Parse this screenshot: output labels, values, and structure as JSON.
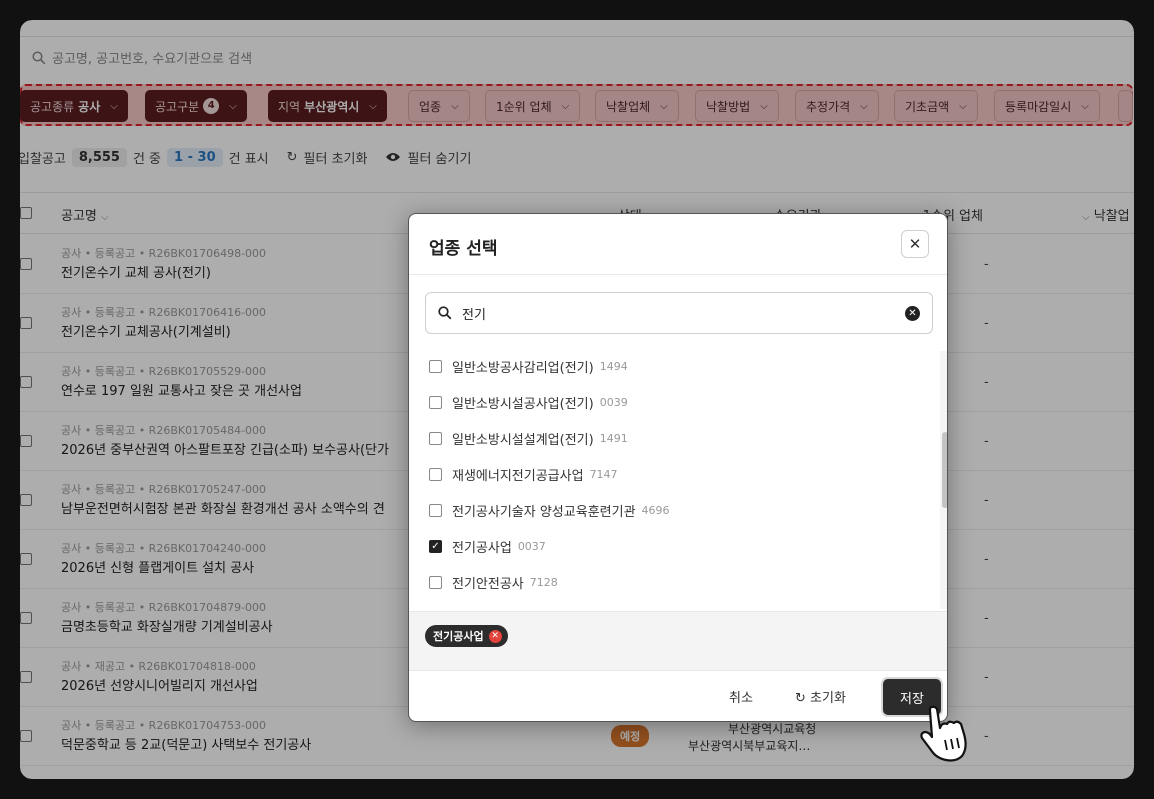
{
  "search": {
    "placeholder": "공고명, 공고번호, 수요기관으로 검색"
  },
  "filters": [
    {
      "label": "공고종류",
      "value": "공사",
      "active": true
    },
    {
      "label": "공고구분",
      "count": "4",
      "active": true
    },
    {
      "label": "지역",
      "value": "부산광역시",
      "active": true
    },
    {
      "label": "업종"
    },
    {
      "label": "1순위 업체"
    },
    {
      "label": "낙찰업체"
    },
    {
      "label": "낙찰방법"
    },
    {
      "label": "추정가격"
    },
    {
      "label": "기초금액"
    },
    {
      "label": "등록마감일시"
    }
  ],
  "stats": {
    "prefix": "입찰공고",
    "total": "8,555",
    "unit": "건 중",
    "range": "1 - 30",
    "suffix": "건 표시",
    "reset_filter": "필터 초기화",
    "hide_filter": "필터 숨기기"
  },
  "table": {
    "headers": {
      "name": "공고명",
      "status": "상태",
      "agency": "수요기관",
      "first_rank": "1순위 업체",
      "winner": "낙찰업"
    },
    "rows": [
      {
        "meta": "공사 • 등록공고 • R26BK01706498-000",
        "title": "전기온수기 교체 공사(전기)",
        "first_rank": "-"
      },
      {
        "meta": "공사 • 등록공고 • R26BK01706416-000",
        "title": "전기온수기 교체공사(기계설비)",
        "first_rank": "-"
      },
      {
        "meta": "공사 • 등록공고 • R26BK01705529-000",
        "title": "연수로 197 일원 교통사고 잦은 곳 개선사업",
        "first_rank": "-"
      },
      {
        "meta": "공사 • 등록공고 • R26BK01705484-000",
        "title": "2026년 중부산권역 아스팔트포장 긴급(소파) 보수공사(단가",
        "first_rank": "-"
      },
      {
        "meta": "공사 • 등록공고 • R26BK01705247-000",
        "title": "남부운전면허시험장 본관 화장실 환경개선 공사 소액수의 견",
        "first_rank": "-"
      },
      {
        "meta": "공사 • 등록공고 • R26BK01704240-000",
        "title": "2026년 신형 플랩게이트 설치 공사",
        "first_rank": "-"
      },
      {
        "meta": "공사 • 등록공고 • R26BK01704879-000",
        "title": "금명초등학교 화장실개량 기계설비공사",
        "first_rank": "-"
      },
      {
        "meta": "공사 • 재공고 • R26BK01704818-000",
        "title": "2026년 선양시니어빌리지 개선사업",
        "first_rank": "-"
      },
      {
        "meta": "공사 • 등록공고 • R26BK01704753-000",
        "title": "덕문중학교 등 2교(덕문고) 사택보수 전기공사",
        "status": "예정",
        "agency_line1": "부산광역시교육청",
        "agency_line2": "부산광역시북부교육지…",
        "first_rank": "-"
      }
    ]
  },
  "modal": {
    "title": "업종 선택",
    "search_value": "전기",
    "items": [
      {
        "name": "일반소방공사감리업(전기)",
        "code": "1494",
        "checked": false
      },
      {
        "name": "일반소방시설공사업(전기)",
        "code": "0039",
        "checked": false
      },
      {
        "name": "일반소방시설설계업(전기)",
        "code": "1491",
        "checked": false
      },
      {
        "name": "재생에너지전기공급사업",
        "code": "7147",
        "checked": false
      },
      {
        "name": "전기공사기술자 양성교육훈련기관",
        "code": "4696",
        "checked": false
      },
      {
        "name": "전기공사업",
        "code": "0037",
        "checked": true
      },
      {
        "name": "전기안전공사",
        "code": "7128",
        "checked": false
      }
    ],
    "selected_tags": [
      "전기공사업"
    ],
    "cancel": "취소",
    "reset": "초기화",
    "save": "저장"
  },
  "colors": {
    "active_chip": "#5b1d1f",
    "highlight": "#e0232a",
    "status_badge": "#d9772c",
    "save_button": "#2c2c2c"
  }
}
